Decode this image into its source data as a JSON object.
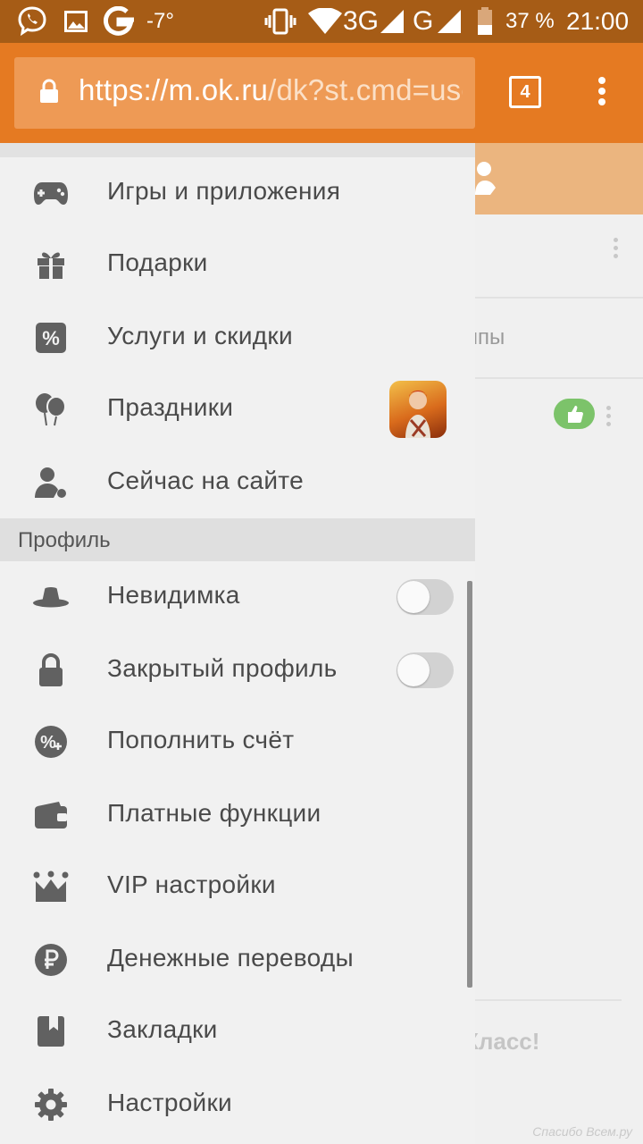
{
  "status_bar": {
    "temperature": "-7°",
    "network": "3G",
    "network2": "G",
    "battery": "37 %",
    "time": "21:00"
  },
  "browser": {
    "url_main": "https://m.ok.ru",
    "url_rest": "/dk?st.cmd=use",
    "tab_count": "4"
  },
  "background_page": {
    "tab_label_fragment": "ппы",
    "bottom_text": "Класс!"
  },
  "drawer": {
    "items_top": [
      {
        "label": "Игры и приложения",
        "icon": "gamepad-icon"
      },
      {
        "label": "Подарки",
        "icon": "gift-icon"
      },
      {
        "label": "Услуги и скидки",
        "icon": "percent-icon"
      },
      {
        "label": "Праздники",
        "icon": "balloons-icon"
      },
      {
        "label": "Сейчас на сайте",
        "icon": "user-online-icon"
      }
    ],
    "profile_section": "Профиль",
    "items_profile": [
      {
        "label": "Невидимка",
        "icon": "hat-icon",
        "toggle": false
      },
      {
        "label": "Закрытый профиль",
        "icon": "lock-icon",
        "toggle": false
      },
      {
        "label": "Пополнить счёт",
        "icon": "add-funds-icon"
      },
      {
        "label": "Платные функции",
        "icon": "wallet-icon"
      },
      {
        "label": "VIP настройки",
        "icon": "crown-icon"
      },
      {
        "label": "Денежные переводы",
        "icon": "ruble-icon"
      },
      {
        "label": "Закладки",
        "icon": "bookmark-icon"
      },
      {
        "label": "Настройки",
        "icon": "gear-icon"
      }
    ]
  },
  "watermark": "Спасибо Всем.ру"
}
